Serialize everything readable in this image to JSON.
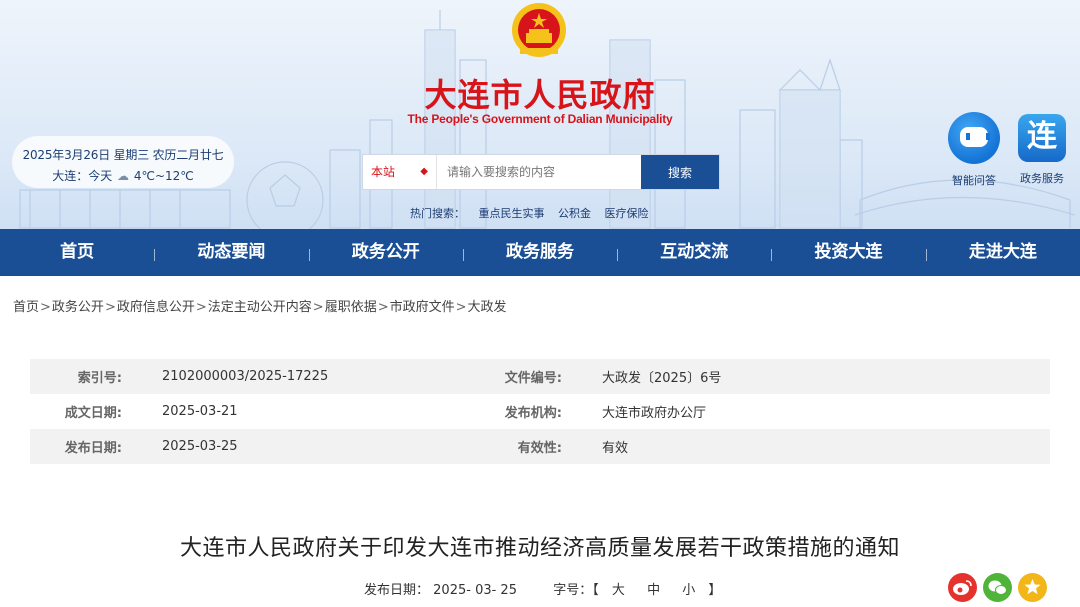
{
  "header": {
    "site_title": "大连市人民政府",
    "site_subtitle": "The People's Government of Dalian Municipality",
    "date_line": "2025年3月26日 星期三 农历二月廿七",
    "weather_city": "大连：今天",
    "weather_temp": "4℃~12℃",
    "weather_icon": "cloud-icon"
  },
  "search": {
    "scope": "本站",
    "placeholder": "请输入要搜索的内容",
    "button": "搜索",
    "hot_label": "热门搜索：",
    "hot_links": [
      "重点民生实事",
      "公积金",
      "医疗保险"
    ]
  },
  "apps": [
    {
      "label": "智能问答",
      "icon": "robot-icon"
    },
    {
      "label": "政务服务",
      "icon": "lian-app-icon",
      "glyph": "连"
    }
  ],
  "nav": [
    "首页",
    "动态要闻",
    "政务公开",
    "政务服务",
    "互动交流",
    "投资大连",
    "走进大连"
  ],
  "breadcrumb": [
    "首页",
    "政务公开",
    "政府信息公开",
    "法定主动公开内容",
    "履职依据",
    "市政府文件",
    "大政发"
  ],
  "info": {
    "rows": [
      {
        "k1": "索引号:",
        "v1": "2102000003/2025-17225",
        "k2": "文件编号:",
        "v2": "大政发〔2025〕6号"
      },
      {
        "k1": "成文日期:",
        "v1": "2025-03-21",
        "k2": "发布机构:",
        "v2": "大连市政府办公厅"
      },
      {
        "k1": "发布日期:",
        "v1": "2025-03-25",
        "k2": "有效性:",
        "v2": "有效"
      }
    ]
  },
  "article": {
    "title": "大连市人民政府关于印发大连市推动经济高质量发展若干政策措施的通知",
    "date_label": "发布日期：",
    "date_value": "2025- 03- 25",
    "size_label": "字号：【",
    "size_large": "大",
    "size_medium": "中",
    "size_small": "小",
    "size_end": "】"
  },
  "share": [
    "weibo-icon",
    "wechat-icon",
    "favorite-star-icon"
  ],
  "colors": {
    "brand_red": "#d7141a",
    "nav_blue": "#1a4f96"
  }
}
